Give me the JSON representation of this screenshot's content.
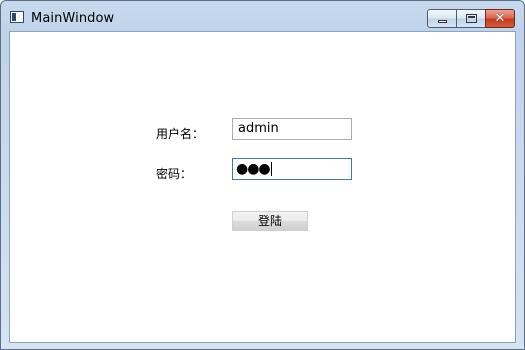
{
  "window": {
    "title": "MainWindow"
  },
  "form": {
    "username_label": "用户名：",
    "username_value": "admin",
    "password_label": "密码：",
    "password_mask": "●●●",
    "login_label": "登陆"
  },
  "icons": {
    "app": "window-icon",
    "minimize": "minimize-icon",
    "maximize": "maximize-icon",
    "close": "close-icon"
  }
}
